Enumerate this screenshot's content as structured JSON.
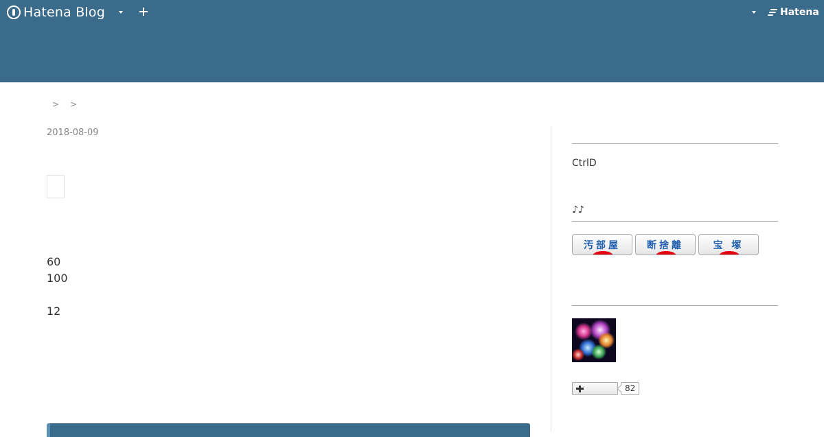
{
  "globalbar": {
    "logo_text": "Hatena Blog",
    "hatena_text": "Hatena"
  },
  "breadcrumb": {
    "separators": [
      ">",
      ">"
    ]
  },
  "entry": {
    "date": "2018-08-09",
    "lines": [
      "60",
      "100",
      "",
      "12"
    ]
  },
  "sidebar": {
    "profile_text": "CtrlD",
    "music_text": "♪♪",
    "badges": [
      {
        "label": "汚部屋"
      },
      {
        "label": "断捨離"
      },
      {
        "label": "宝 塚"
      }
    ],
    "subscribe": {
      "count": "82"
    }
  },
  "colors": {
    "header": "#3a6b8b",
    "badge_text": "#1f5fb0",
    "badge_dot": "#e60012"
  }
}
